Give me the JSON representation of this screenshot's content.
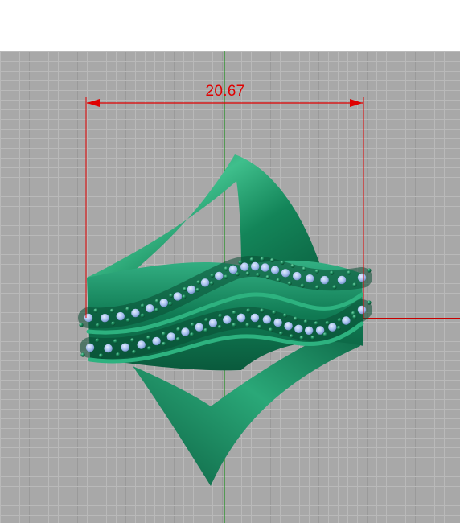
{
  "viewport": {
    "background_color": "#a8a8a8",
    "grid_minor_color": "#b9b9b9",
    "grid_major_color": "#9a9a9a",
    "x_axis_color": "#c80000",
    "y_axis_color": "#008a00"
  },
  "dimension": {
    "value": "20.67",
    "color": "#e00000"
  },
  "model": {
    "name": "ring",
    "metal_color": "#13805a",
    "stone_color": "#a6c0ee",
    "bead_color": "#1a6e4c"
  }
}
